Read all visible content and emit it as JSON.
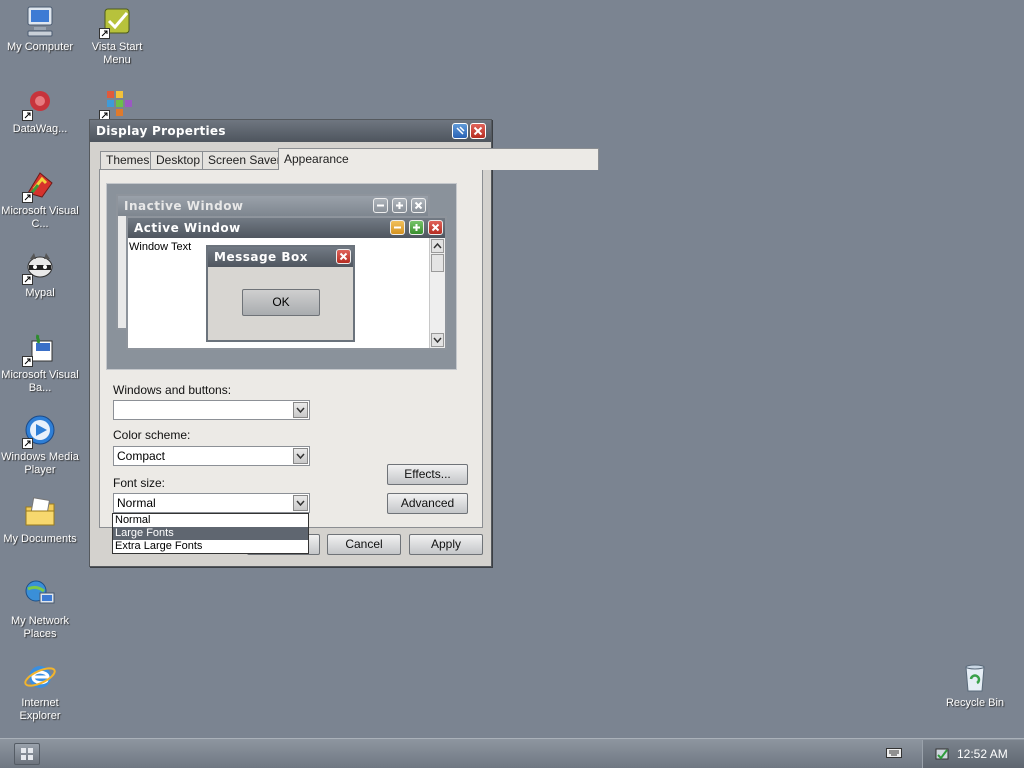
{
  "desktop": {
    "icons": [
      {
        "label": "My Computer",
        "icon": "computer-icon"
      },
      {
        "label": "Vista Start Menu",
        "icon": "vista-start-menu-icon"
      },
      {
        "label": "DataWag...",
        "icon": "datawag-icon"
      },
      {
        "label": "Microsoft Visual C...",
        "icon": "visual-c-icon"
      },
      {
        "label": "Mypal",
        "icon": "mypal-icon"
      },
      {
        "label": "Microsoft Visual Ba...",
        "icon": "visual-basic-icon"
      },
      {
        "label": "Windows Media Player",
        "icon": "media-player-icon"
      },
      {
        "label": "My Documents",
        "icon": "documents-folder-icon"
      },
      {
        "label": "My Network Places",
        "icon": "network-places-icon"
      },
      {
        "label": "Internet Explorer",
        "icon": "internet-explorer-icon"
      },
      {
        "label": "Recycle Bin",
        "icon": "recycle-bin-icon"
      }
    ]
  },
  "dialog": {
    "title": "Display Properties",
    "tabs": [
      "Themes",
      "Desktop",
      "Screen Saver",
      "Appearance"
    ],
    "active_tab": "Appearance",
    "preview": {
      "inactive_title": "Inactive Window",
      "active_title": "Active Window",
      "window_text": "Window Text",
      "message_title": "Message Box",
      "ok_label": "OK"
    },
    "windows_buttons": {
      "label": "Windows and buttons:",
      "value": ""
    },
    "color_scheme": {
      "label": "Color scheme:",
      "value": "Compact"
    },
    "font_size": {
      "label": "Font size:",
      "value": "Normal",
      "options": [
        "Normal",
        "Large Fonts",
        "Extra Large Fonts"
      ],
      "highlighted": "Large Fonts"
    },
    "effects_label": "Effects...",
    "advanced_label": "Advanced",
    "cancel_label": "Cancel",
    "apply_label": "Apply"
  },
  "taskbar": {
    "clock": "12:52 AM"
  },
  "colors": {
    "desktop_bg": "#7b8491",
    "titlebar": "#4e555e",
    "close_red": "#b52d22",
    "highlight": "#5f6670"
  }
}
